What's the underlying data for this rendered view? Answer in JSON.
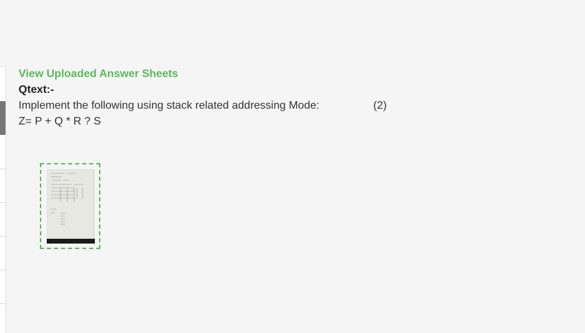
{
  "section_title": "View Uploaded Answer Sheets",
  "qtext_label": "Qtext:-",
  "question": {
    "text": "Implement the following using stack related addressing Mode:",
    "marks": "(2)",
    "expression": "Z= P + Q * R ? S"
  },
  "answer_sheets": [
    {
      "icon": "handwritten-page-thumbnail"
    }
  ],
  "colors": {
    "accent": "#5cb85c",
    "background": "#f5f5f5",
    "text": "#333333"
  }
}
